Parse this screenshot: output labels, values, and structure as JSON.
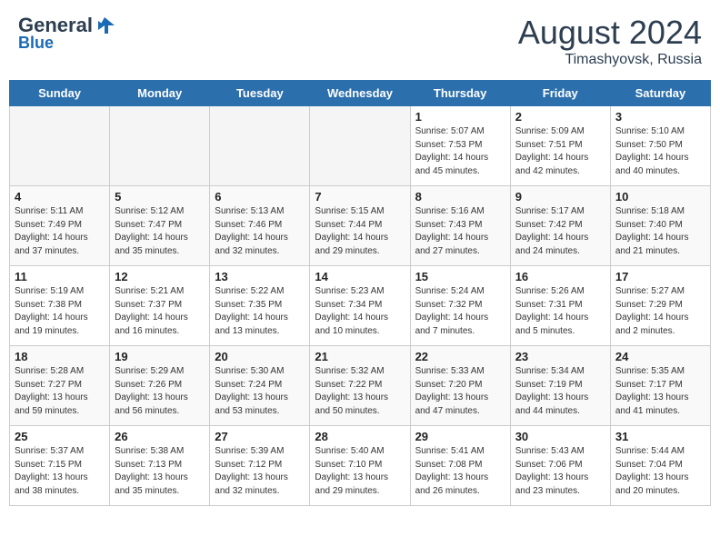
{
  "header": {
    "logo_line1": "General",
    "logo_line2": "Blue",
    "month": "August 2024",
    "location": "Timashyovsk, Russia"
  },
  "days_of_week": [
    "Sunday",
    "Monday",
    "Tuesday",
    "Wednesday",
    "Thursday",
    "Friday",
    "Saturday"
  ],
  "weeks": [
    [
      {
        "day": "",
        "empty": true
      },
      {
        "day": "",
        "empty": true
      },
      {
        "day": "",
        "empty": true
      },
      {
        "day": "",
        "empty": true
      },
      {
        "day": "1",
        "sunrise": "5:07 AM",
        "sunset": "7:53 PM",
        "daylight": "14 hours and 45 minutes."
      },
      {
        "day": "2",
        "sunrise": "5:09 AM",
        "sunset": "7:51 PM",
        "daylight": "14 hours and 42 minutes."
      },
      {
        "day": "3",
        "sunrise": "5:10 AM",
        "sunset": "7:50 PM",
        "daylight": "14 hours and 40 minutes."
      }
    ],
    [
      {
        "day": "4",
        "sunrise": "5:11 AM",
        "sunset": "7:49 PM",
        "daylight": "14 hours and 37 minutes."
      },
      {
        "day": "5",
        "sunrise": "5:12 AM",
        "sunset": "7:47 PM",
        "daylight": "14 hours and 35 minutes."
      },
      {
        "day": "6",
        "sunrise": "5:13 AM",
        "sunset": "7:46 PM",
        "daylight": "14 hours and 32 minutes."
      },
      {
        "day": "7",
        "sunrise": "5:15 AM",
        "sunset": "7:44 PM",
        "daylight": "14 hours and 29 minutes."
      },
      {
        "day": "8",
        "sunrise": "5:16 AM",
        "sunset": "7:43 PM",
        "daylight": "14 hours and 27 minutes."
      },
      {
        "day": "9",
        "sunrise": "5:17 AM",
        "sunset": "7:42 PM",
        "daylight": "14 hours and 24 minutes."
      },
      {
        "day": "10",
        "sunrise": "5:18 AM",
        "sunset": "7:40 PM",
        "daylight": "14 hours and 21 minutes."
      }
    ],
    [
      {
        "day": "11",
        "sunrise": "5:19 AM",
        "sunset": "7:38 PM",
        "daylight": "14 hours and 19 minutes."
      },
      {
        "day": "12",
        "sunrise": "5:21 AM",
        "sunset": "7:37 PM",
        "daylight": "14 hours and 16 minutes."
      },
      {
        "day": "13",
        "sunrise": "5:22 AM",
        "sunset": "7:35 PM",
        "daylight": "14 hours and 13 minutes."
      },
      {
        "day": "14",
        "sunrise": "5:23 AM",
        "sunset": "7:34 PM",
        "daylight": "14 hours and 10 minutes."
      },
      {
        "day": "15",
        "sunrise": "5:24 AM",
        "sunset": "7:32 PM",
        "daylight": "14 hours and 7 minutes."
      },
      {
        "day": "16",
        "sunrise": "5:26 AM",
        "sunset": "7:31 PM",
        "daylight": "14 hours and 5 minutes."
      },
      {
        "day": "17",
        "sunrise": "5:27 AM",
        "sunset": "7:29 PM",
        "daylight": "14 hours and 2 minutes."
      }
    ],
    [
      {
        "day": "18",
        "sunrise": "5:28 AM",
        "sunset": "7:27 PM",
        "daylight": "13 hours and 59 minutes."
      },
      {
        "day": "19",
        "sunrise": "5:29 AM",
        "sunset": "7:26 PM",
        "daylight": "13 hours and 56 minutes."
      },
      {
        "day": "20",
        "sunrise": "5:30 AM",
        "sunset": "7:24 PM",
        "daylight": "13 hours and 53 minutes."
      },
      {
        "day": "21",
        "sunrise": "5:32 AM",
        "sunset": "7:22 PM",
        "daylight": "13 hours and 50 minutes."
      },
      {
        "day": "22",
        "sunrise": "5:33 AM",
        "sunset": "7:20 PM",
        "daylight": "13 hours and 47 minutes."
      },
      {
        "day": "23",
        "sunrise": "5:34 AM",
        "sunset": "7:19 PM",
        "daylight": "13 hours and 44 minutes."
      },
      {
        "day": "24",
        "sunrise": "5:35 AM",
        "sunset": "7:17 PM",
        "daylight": "13 hours and 41 minutes."
      }
    ],
    [
      {
        "day": "25",
        "sunrise": "5:37 AM",
        "sunset": "7:15 PM",
        "daylight": "13 hours and 38 minutes."
      },
      {
        "day": "26",
        "sunrise": "5:38 AM",
        "sunset": "7:13 PM",
        "daylight": "13 hours and 35 minutes."
      },
      {
        "day": "27",
        "sunrise": "5:39 AM",
        "sunset": "7:12 PM",
        "daylight": "13 hours and 32 minutes."
      },
      {
        "day": "28",
        "sunrise": "5:40 AM",
        "sunset": "7:10 PM",
        "daylight": "13 hours and 29 minutes."
      },
      {
        "day": "29",
        "sunrise": "5:41 AM",
        "sunset": "7:08 PM",
        "daylight": "13 hours and 26 minutes."
      },
      {
        "day": "30",
        "sunrise": "5:43 AM",
        "sunset": "7:06 PM",
        "daylight": "13 hours and 23 minutes."
      },
      {
        "day": "31",
        "sunrise": "5:44 AM",
        "sunset": "7:04 PM",
        "daylight": "13 hours and 20 minutes."
      }
    ]
  ]
}
